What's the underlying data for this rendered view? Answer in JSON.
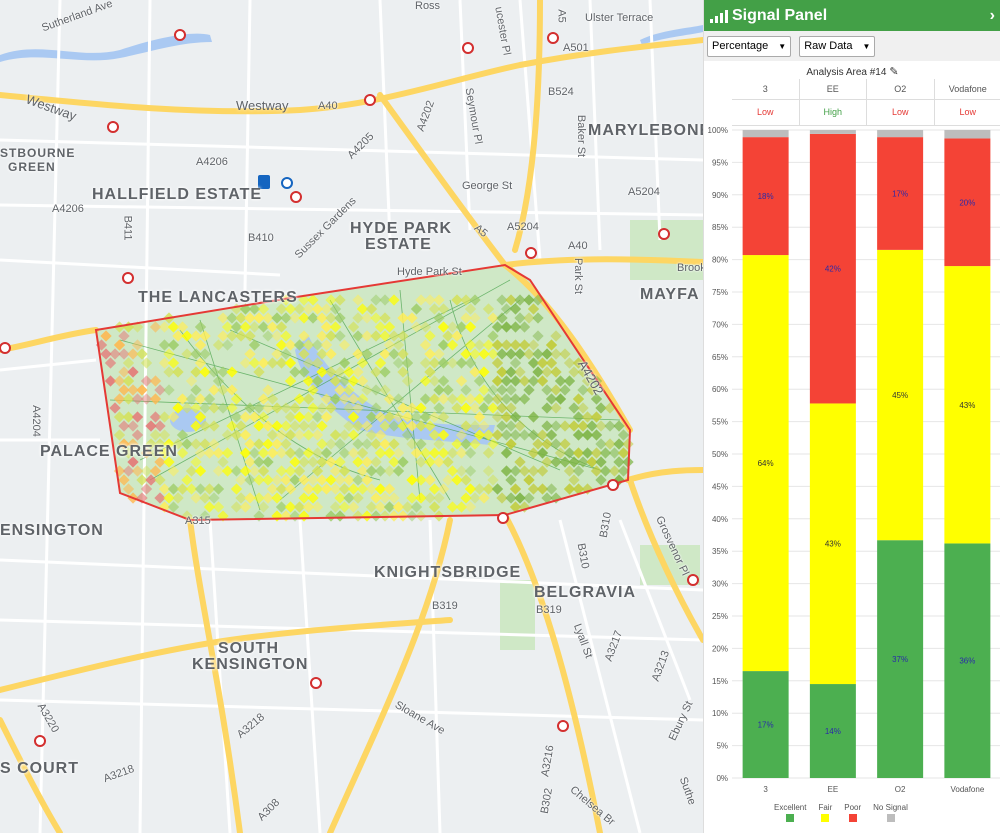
{
  "map": {
    "districts": [
      "MARYLEBONE",
      "HALLFIELD ESTATE",
      "HYDE PARK",
      "ESTATE",
      "THE LANCASTERS",
      "MAYFA",
      "PALACE GREEN",
      "ENSINGTON",
      "KNIGHTSBRIDGE",
      "BELGRAVIA",
      "SOUTH",
      "KENSINGTON",
      "S COURT"
    ],
    "areas": [
      "STBOURNE",
      "GREEN"
    ],
    "roads": [
      "Westway",
      "Westway",
      "A40",
      "A501",
      "B524",
      "Baker St",
      "A5204",
      "George St",
      "A5",
      "A5204",
      "A40",
      "Park St",
      "Brook",
      "Sussex Gardens",
      "B410",
      "A4206",
      "A4206",
      "B411",
      "Hyde Park St",
      "A4202",
      "A4204",
      "B310",
      "Grosvenor Pl",
      "B319",
      "B319",
      "B310",
      "Lyall St",
      "A3217",
      "A3213",
      "Ebury St",
      "Sloane Ave",
      "A3218",
      "A3218",
      "A3220",
      "A308",
      "A3216",
      "B302",
      "Chelsea Br",
      "Suthe",
      "Sutherland Ave",
      "Ross",
      "Ulster Terrace",
      "Seymour Pl",
      "ucester Pl",
      "A4205",
      "A315",
      "A4202",
      "A5"
    ],
    "colors": {
      "polygon": "#e53935",
      "water": "#aac9f2",
      "park": "#cfe8c6",
      "major_road": "#fdd663",
      "minor_road": "#ffffff",
      "background": "#eceff1"
    }
  },
  "panel": {
    "title": "Signal Panel",
    "header_icon": "signal-bars-icon",
    "collapse_icon": "chevron-right-icon",
    "header_color": "#43a047",
    "mode_select": "Percentage",
    "data_select": "Raw Data",
    "area_title": "Analysis Area #14",
    "edit_icon": "pencil-icon",
    "operators": [
      "3",
      "EE",
      "O2",
      "Vodafone"
    ],
    "qualities": [
      {
        "label": "Low",
        "color": "#e53935"
      },
      {
        "label": "High",
        "color": "#43a047"
      },
      {
        "label": "Low",
        "color": "#e53935"
      },
      {
        "label": "Low",
        "color": "#e53935"
      }
    ]
  },
  "chart_data": {
    "type": "bar",
    "stacked": true,
    "categories": [
      "3",
      "EE",
      "O2",
      "Vodafone"
    ],
    "series": [
      {
        "name": "Excellent",
        "color": "#4caf50",
        "values": [
          16.5,
          14.5,
          36.7,
          36.2
        ],
        "labels": [
          "17%",
          "14%",
          "37%",
          "36%"
        ]
      },
      {
        "name": "Fair",
        "color": "#ffff00",
        "values": [
          64.2,
          43.3,
          44.8,
          42.8
        ],
        "labels": [
          "64%",
          "43%",
          "45%",
          "43%"
        ]
      },
      {
        "name": "Poor",
        "color": "#f44336",
        "values": [
          18.2,
          41.6,
          17.4,
          19.7
        ],
        "labels": [
          "18%",
          "42%",
          "17%",
          "20%"
        ]
      },
      {
        "name": "No Signal",
        "color": "#bdbdbd",
        "values": [
          1.1,
          0.6,
          1.1,
          1.3
        ],
        "labels": [
          "",
          "",
          "",
          ""
        ]
      }
    ],
    "ylim": [
      0,
      100
    ],
    "yticks": [
      "0%",
      "5%",
      "10%",
      "15%",
      "20%",
      "25%",
      "30%",
      "35%",
      "40%",
      "45%",
      "50%",
      "55%",
      "60%",
      "65%",
      "70%",
      "75%",
      "80%",
      "85%",
      "90%",
      "95%",
      "100%"
    ],
    "grid": true,
    "legend": "bottom"
  }
}
